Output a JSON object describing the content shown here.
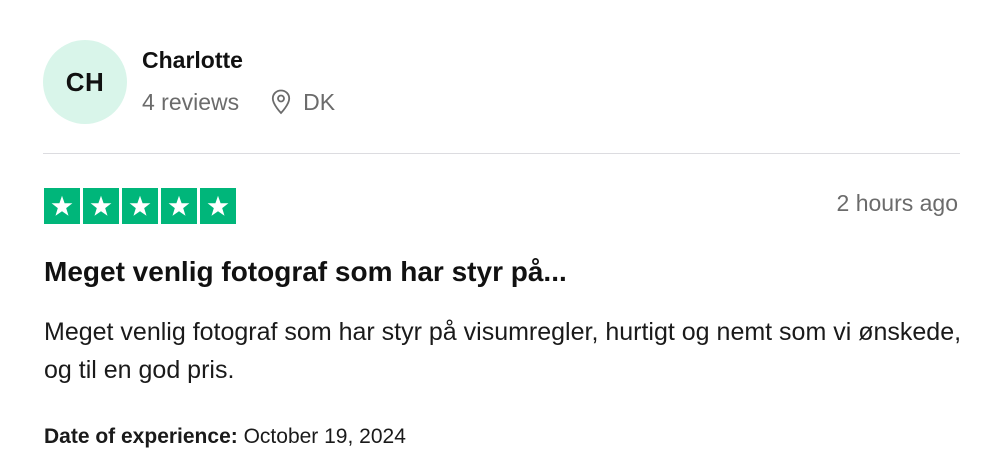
{
  "reviewer": {
    "initials": "CH",
    "name": "Charlotte",
    "reviews_count": "4 reviews",
    "country": "DK",
    "avatar_color": "#d9f5ea"
  },
  "review": {
    "rating": 5,
    "max_rating": 5,
    "star_color": "#00b67a",
    "time_ago": "2 hours ago",
    "title": "Meget venlig fotograf som har styr på...",
    "body": "Meget venlig fotograf som har styr på visumregler, hurtigt og nemt som vi ønskede, og til en god pris.",
    "date_label": "Date of experience:",
    "date_value": "October 19, 2024"
  },
  "icons": {
    "location": "location-pin-icon",
    "star": "star-icon"
  }
}
